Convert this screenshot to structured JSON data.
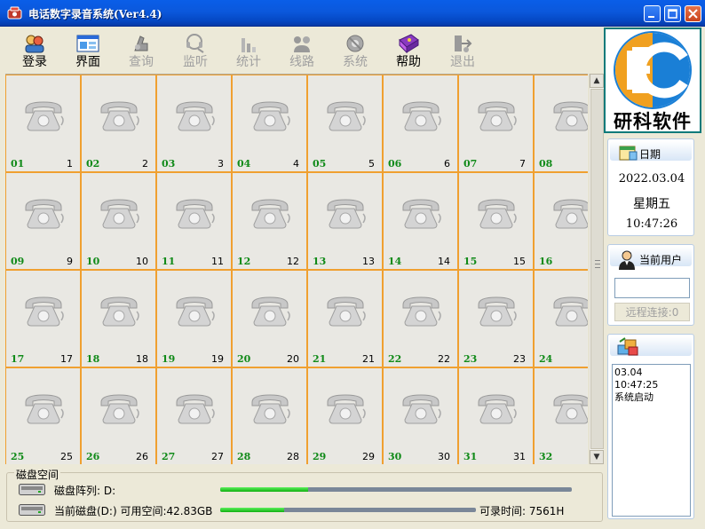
{
  "window": {
    "title": "电话数字录音系统(Ver4.4)"
  },
  "toolbar": {
    "items": [
      {
        "label": "登录",
        "icon": "login-icon",
        "enabled": true
      },
      {
        "label": "界面",
        "icon": "interface-icon",
        "enabled": true
      },
      {
        "label": "查询",
        "icon": "query-icon",
        "enabled": false
      },
      {
        "label": "监听",
        "icon": "monitor-icon",
        "enabled": false
      },
      {
        "label": "统计",
        "icon": "statistics-icon",
        "enabled": false
      },
      {
        "label": "线路",
        "icon": "line-icon",
        "enabled": false
      },
      {
        "label": "系统",
        "icon": "system-icon",
        "enabled": false
      },
      {
        "label": "帮助",
        "icon": "help-icon",
        "enabled": true
      },
      {
        "label": "退出",
        "icon": "exit-icon",
        "enabled": false
      }
    ]
  },
  "channels": [
    {
      "ch": "01",
      "line": "1"
    },
    {
      "ch": "02",
      "line": "2"
    },
    {
      "ch": "03",
      "line": "3"
    },
    {
      "ch": "04",
      "line": "4"
    },
    {
      "ch": "05",
      "line": "5"
    },
    {
      "ch": "06",
      "line": "6"
    },
    {
      "ch": "07",
      "line": "7"
    },
    {
      "ch": "08",
      "line": "8"
    },
    {
      "ch": "09",
      "line": "9"
    },
    {
      "ch": "10",
      "line": "10"
    },
    {
      "ch": "11",
      "line": "11"
    },
    {
      "ch": "12",
      "line": "12"
    },
    {
      "ch": "13",
      "line": "13"
    },
    {
      "ch": "14",
      "line": "14"
    },
    {
      "ch": "15",
      "line": "15"
    },
    {
      "ch": "16",
      "line": "16"
    },
    {
      "ch": "17",
      "line": "17"
    },
    {
      "ch": "18",
      "line": "18"
    },
    {
      "ch": "19",
      "line": "19"
    },
    {
      "ch": "20",
      "line": "20"
    },
    {
      "ch": "21",
      "line": "21"
    },
    {
      "ch": "22",
      "line": "22"
    },
    {
      "ch": "23",
      "line": "23"
    },
    {
      "ch": "24",
      "line": "24"
    },
    {
      "ch": "25",
      "line": "25"
    },
    {
      "ch": "26",
      "line": "26"
    },
    {
      "ch": "27",
      "line": "27"
    },
    {
      "ch": "28",
      "line": "28"
    },
    {
      "ch": "29",
      "line": "29"
    },
    {
      "ch": "30",
      "line": "30"
    },
    {
      "ch": "31",
      "line": "31"
    },
    {
      "ch": "32",
      "line": "32"
    }
  ],
  "disk": {
    "group_title": "磁盘空间",
    "array_label": "磁盘阵列:  D:",
    "array_used_fraction": 0.25,
    "current_label": "当前磁盘(D:) 可用空间:42.83GB",
    "current_used_fraction": 0.25,
    "record_time": "可录时间:  7561H"
  },
  "brand": {
    "logo_text": "研科软件",
    "colors": {
      "orange": "#f0a020",
      "blue": "#1a7fd6",
      "teal": "#0a7a7a"
    }
  },
  "date_panel": {
    "title": "日期",
    "date": "2022.03.04",
    "weekday": "星期五",
    "time": "10:47:26"
  },
  "user_panel": {
    "title": "当前用户",
    "user_value": "",
    "remote_label": "远程连接:0"
  },
  "log_panel": {
    "lines": [
      "03.04 10:47:25",
      "系统启动"
    ]
  }
}
